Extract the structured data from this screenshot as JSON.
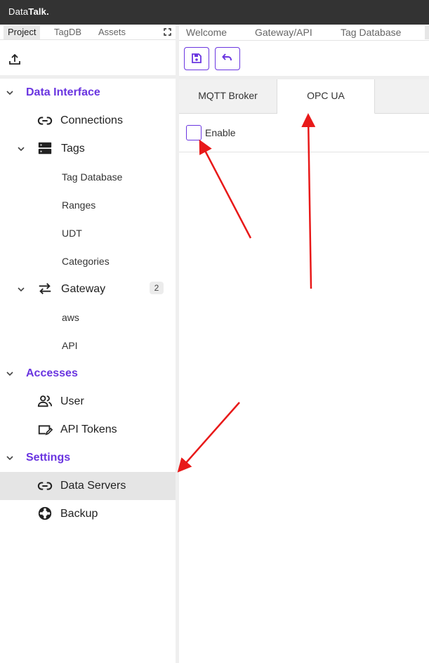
{
  "app": {
    "brand_prefix": "Data",
    "brand_suffix": "Talk."
  },
  "left_panel": {
    "tabs": [
      {
        "label": "Project",
        "active": true
      },
      {
        "label": "TagDB",
        "active": false
      },
      {
        "label": "Assets",
        "active": false
      }
    ],
    "expand_icon": "expand-corners-icon",
    "upload_icon": "upload-icon",
    "tree": {
      "data_interface": {
        "label": "Data Interface",
        "connections": {
          "label": "Connections",
          "icon": "link-icon"
        },
        "tags": {
          "label": "Tags",
          "icon": "storage-icon",
          "children": [
            "Tag Database",
            "Ranges",
            "UDT",
            "Categories"
          ]
        },
        "gateway": {
          "label": "Gateway",
          "icon": "swap-arrows-icon",
          "badge": "2",
          "children": [
            "aws",
            "API"
          ]
        }
      },
      "accesses": {
        "label": "Accesses",
        "user": {
          "label": "User",
          "icon": "users-icon"
        },
        "api_tokens": {
          "label": "API Tokens",
          "icon": "token-edit-icon"
        }
      },
      "settings": {
        "label": "Settings",
        "data_servers": {
          "label": "Data Servers",
          "icon": "link-icon",
          "selected": true
        },
        "backup": {
          "label": "Backup",
          "icon": "lifebuoy-icon"
        }
      }
    }
  },
  "right_panel": {
    "tabs": [
      "Welcome",
      "Gateway/API",
      "Tag Database"
    ],
    "toolbar": {
      "save_icon": "save-icon",
      "undo_icon": "undo-icon"
    },
    "protocol_tabs": [
      {
        "label": "MQTT Broker",
        "active": false
      },
      {
        "label": "OPC UA",
        "active": true
      }
    ],
    "enable": {
      "label": "Enable",
      "checked": false
    }
  },
  "colors": {
    "accent": "#6a35e0",
    "titlebar": "#333333",
    "selected_row": "#e5e5e5",
    "annotation_arrow": "#e81919"
  }
}
